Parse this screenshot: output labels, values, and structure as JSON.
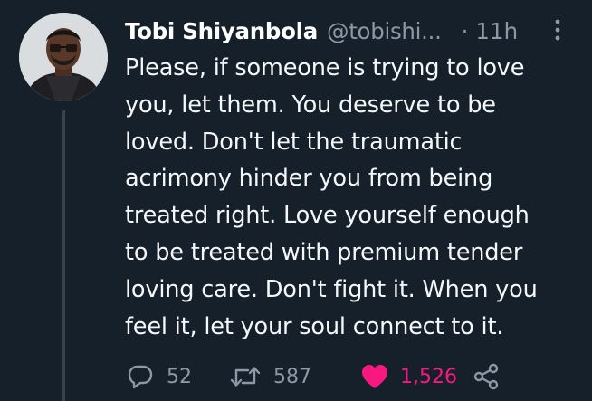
{
  "tweet": {
    "author": {
      "display_name": "Tobi Shiyanbola",
      "handle": "@tobishi...",
      "avatar_icon": "profile-photo"
    },
    "separator": "·",
    "timestamp": "11h",
    "text_lines": [
      "Please, if someone is trying to love",
      "you, let them. You deserve to be",
      "loved. Don't let the traumatic",
      "acrimony hinder you from being",
      "treated right. Love yourself enough",
      "to be treated with premium tender",
      "loving care. Don't fight it. When you",
      "feel it, let your soul connect to it."
    ],
    "actions": {
      "reply": {
        "icon": "reply-icon",
        "count": "52"
      },
      "retweet": {
        "icon": "retweet-icon",
        "count": "587"
      },
      "like": {
        "icon": "heart-icon",
        "count": "1,526",
        "active": true,
        "color": "#f91880"
      },
      "share": {
        "icon": "share-icon"
      }
    }
  },
  "colors": {
    "background": "#15202b",
    "secondary_text": "#8b98a5",
    "primary_text": "#ffffff",
    "like_active": "#f91880",
    "thread_line": "#38444d"
  }
}
